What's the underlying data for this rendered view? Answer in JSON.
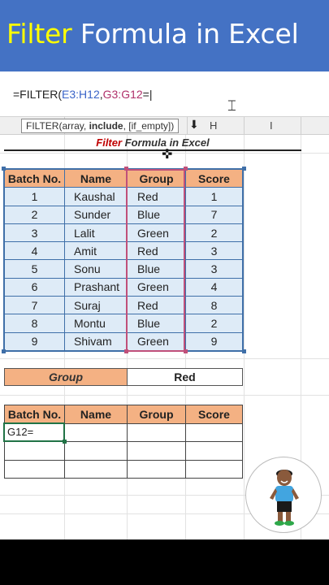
{
  "banner": {
    "title_accent": "Filter",
    "title_rest": " Formula in Excel"
  },
  "formula_bar": {
    "prefix": "=FILTER(",
    "ref1": "E3:H12",
    "comma": ",",
    "ref2": "G3:G12",
    "suffix": "=|"
  },
  "tooltip": {
    "func": "FILTER(array, ",
    "bold_arg": "include",
    "rest": ", [if_empty])"
  },
  "columns": {
    "h": "H",
    "i": "I"
  },
  "sheet_title": {
    "part1": "Filter",
    "part2": " Formula in Excel"
  },
  "data_table": {
    "headers": [
      "Batch No.",
      "Name",
      "Group",
      "Score"
    ],
    "rows": [
      [
        "1",
        "Kaushal",
        "Red",
        "1"
      ],
      [
        "2",
        "Sunder",
        "Blue",
        "7"
      ],
      [
        "3",
        "Lalit",
        "Green",
        "2"
      ],
      [
        "4",
        "Amit",
        "Red",
        "3"
      ],
      [
        "5",
        "Sonu",
        "Blue",
        "3"
      ],
      [
        "6",
        "Prashant",
        "Green",
        "4"
      ],
      [
        "7",
        "Suraj",
        "Red",
        "8"
      ],
      [
        "8",
        "Montu",
        "Blue",
        "2"
      ],
      [
        "9",
        "Shivam",
        "Green",
        "9"
      ]
    ]
  },
  "criteria": {
    "label": "Group",
    "value": "Red"
  },
  "result_table": {
    "headers": [
      "Batch No.",
      "Name",
      "Group",
      "Score"
    ],
    "active_cell_text": "G12="
  },
  "colors": {
    "banner": "#4472c4",
    "accent": "#ffff00",
    "header_fill": "#f4b183",
    "data_fill": "#deebf7",
    "range_blue": "#3f6fa8",
    "range_pink": "#c0507a"
  }
}
